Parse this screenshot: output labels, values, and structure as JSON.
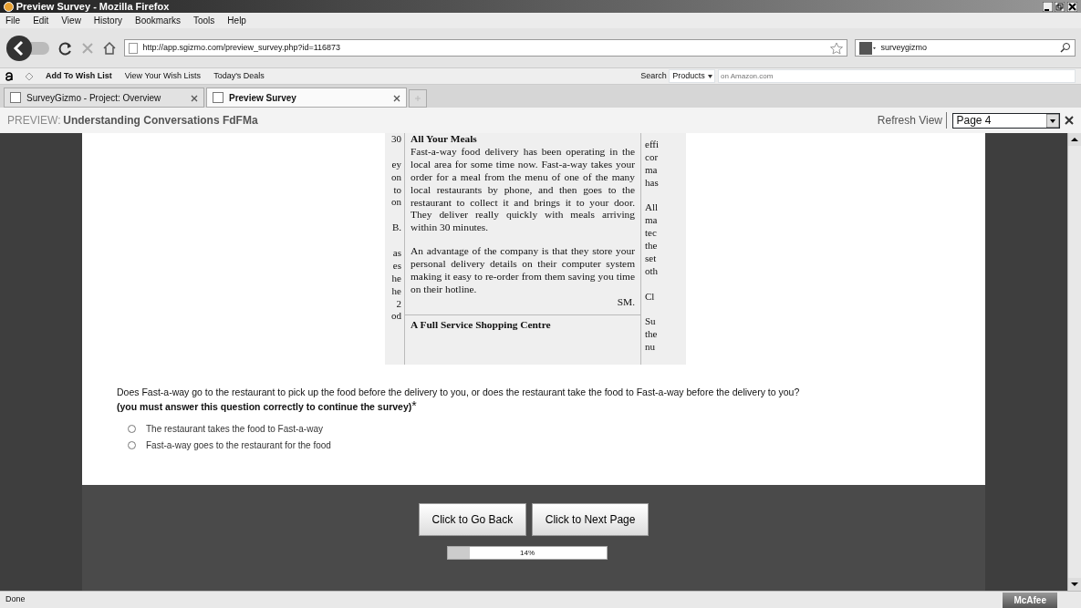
{
  "window": {
    "title": "Preview Survey - Mozilla Firefox"
  },
  "menu": [
    "File",
    "Edit",
    "View",
    "History",
    "Bookmarks",
    "Tools",
    "Help"
  ],
  "address_bar": {
    "value": "http://app.sgizmo.com/preview_survey.php?id=116873"
  },
  "search_bar": {
    "value": "surveygizmo"
  },
  "amazon_toolbar": {
    "items": [
      "Add To Wish List",
      "View Your Wish Lists",
      "Today's Deals"
    ],
    "search_label": "Search",
    "category": "Products",
    "placeholder": "on Amazon.com"
  },
  "tabs": [
    {
      "label": "SurveyGizmo - Project: Overview",
      "selected": false
    },
    {
      "label": "Preview Survey",
      "selected": true
    }
  ],
  "preview_bar": {
    "prefix": "PREVIEW:",
    "title": "Understanding Conversations FdFMa",
    "refresh": "Refresh View",
    "page": "Page 4"
  },
  "document": {
    "left_fragments": [
      [
        "30"
      ],
      [
        "ey",
        "on",
        "to",
        "on"
      ],
      [
        "B."
      ],
      [
        "as",
        "es",
        "he",
        "he",
        "2",
        "od"
      ]
    ],
    "heading": "All Your Meals",
    "paragraphs": [
      "Fast-a-way food delivery has been operating in the local area for some time now. Fast-a-way takes your order for a meal from the menu of one of the many local restaurants by phone, and then goes to the restaurant to collect it and brings it to your door. They deliver really quickly with meals arriving within 30 minutes.",
      "An advantage of the company is that they store your personal delivery details on their computer system making it easy to re-order from them saving you time on their hotline."
    ],
    "signature": "SM.",
    "next_heading": "A Full Service Shopping Centre",
    "right_fragments": [
      [
        "effi",
        "cor",
        "ma",
        "has"
      ],
      [
        "All",
        "ma",
        "tec",
        "the",
        "set",
        "oth"
      ],
      [
        "Cl"
      ],
      [
        "Su",
        "the",
        "nu"
      ]
    ]
  },
  "question": {
    "text": "Does Fast-a-way go to the restaurant to pick up the food before the delivery to you, or does the restaurant take the food to Fast-a-way before the delivery to you?",
    "note": "(you must answer this question correctly to continue the survey)",
    "required_mark": "*",
    "options": [
      {
        "label": "The restaurant takes the food to Fast-a-way",
        "selected": false
      },
      {
        "label": "Fast-a-way goes to the restaurant for the food",
        "selected": false
      }
    ]
  },
  "buttons": [
    "Click to Go Back",
    "Click to Next Page"
  ],
  "progress": {
    "level": 0.14,
    "label": "14%"
  },
  "status_bar": {
    "text": "Done",
    "addon": "McAfee"
  }
}
